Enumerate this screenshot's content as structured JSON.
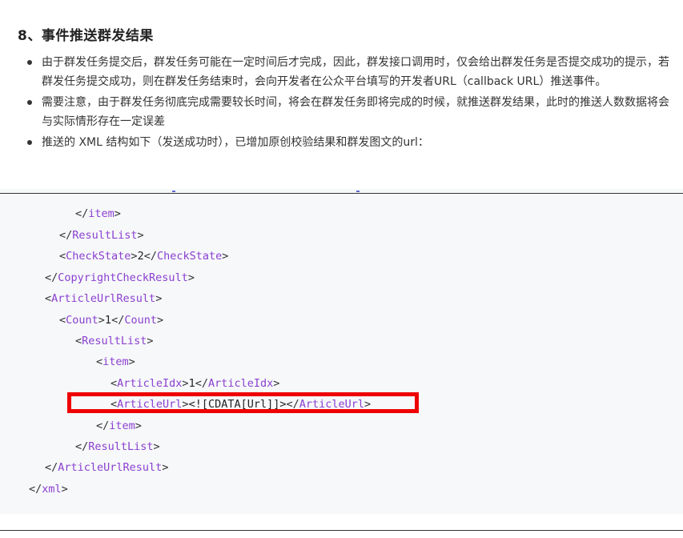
{
  "section": {
    "title": "8、事件推送群发结果",
    "bullets": [
      "由于群发任务提交后，群发任务可能在一定时间后才完成，因此，群发接口调用时，仅会给出群发任务是否提交成功的提示，若群发任务提交成功，则在群发任务结束时，会向开发者在公众平台填写的开发者URL（callback URL）推送事件。",
      "需要注意，由于群发任务彻底完成需要较长时间，将会在群发任务即将完成的时候，就推送群发结果，此时的推送人数数据将会与实际情形存在一定误差",
      "推送的 XML 结构如下（发送成功时），已增加原创校验结果和群发图文的url："
    ]
  },
  "code": {
    "lines": [
      {
        "open": "</",
        "tag": "item",
        "close": ">",
        "value": "",
        "tag2": ""
      },
      {
        "open": "</",
        "tag": "ResultList",
        "close": ">",
        "value": "",
        "tag2": ""
      },
      {
        "open": "<",
        "tag": "CheckState",
        "close": ">",
        "value": "2",
        "tag2": "CheckState"
      },
      {
        "open": "</",
        "tag": "CopyrightCheckResult",
        "close": ">",
        "value": "",
        "tag2": ""
      },
      {
        "open": "<",
        "tag": "ArticleUrlResult",
        "close": ">",
        "value": "",
        "tag2": ""
      },
      {
        "open": "<",
        "tag": "Count",
        "close": ">",
        "value": "1",
        "tag2": "Count"
      },
      {
        "open": "<",
        "tag": "ResultList",
        "close": ">",
        "value": "",
        "tag2": ""
      },
      {
        "open": "<",
        "tag": "item",
        "close": ">",
        "value": "",
        "tag2": ""
      },
      {
        "open": "<",
        "tag": "ArticleIdx",
        "close": ">",
        "value": "1",
        "tag2": "ArticleIdx"
      },
      {
        "open": "<",
        "tag": "ArticleUrl",
        "close": ">",
        "value": "<![CDATA[Url]]>",
        "tag2": "ArticleUrl"
      },
      {
        "open": "</",
        "tag": "item",
        "close": ">",
        "value": "",
        "tag2": ""
      },
      {
        "open": "</",
        "tag": "ResultList",
        "close": ">",
        "value": "",
        "tag2": ""
      },
      {
        "open": "</",
        "tag": "ArticleUrlResult",
        "close": ">",
        "value": "",
        "tag2": ""
      },
      {
        "open": "</",
        "tag": "xml",
        "close": ">",
        "value": "",
        "tag2": ""
      }
    ]
  },
  "colors": {
    "highlight_border": "#ee0000",
    "xml_tag": "#8b3fd0",
    "code_background": "#f6f8fa"
  }
}
